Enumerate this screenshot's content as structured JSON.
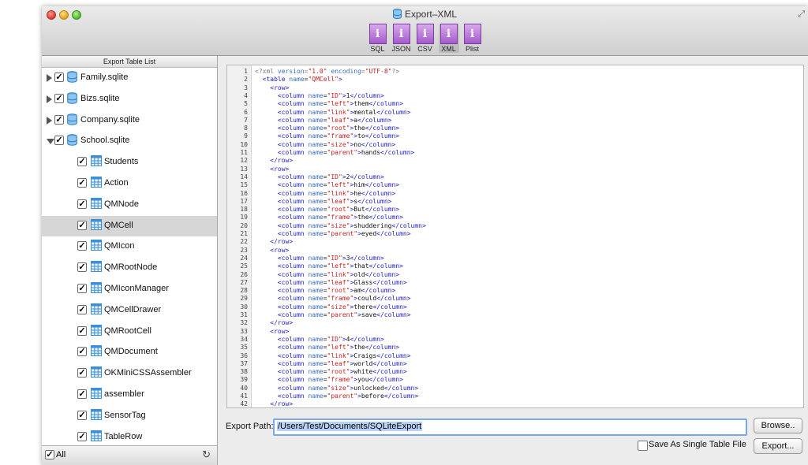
{
  "window": {
    "title": "Export–XML",
    "toolbar": [
      {
        "label": "SQL",
        "icon": "info-icon"
      },
      {
        "label": "JSON",
        "icon": "info-icon"
      },
      {
        "label": "CSV",
        "icon": "info-icon"
      },
      {
        "label": "XML",
        "icon": "info-icon",
        "selected": true
      },
      {
        "label": "Plist",
        "icon": "info-icon"
      }
    ]
  },
  "sidebar": {
    "header": "Export Table List",
    "databases": [
      {
        "label": "Family.sqlite",
        "expanded": false,
        "checked": true
      },
      {
        "label": "Bizs.sqlite",
        "expanded": false,
        "checked": true
      },
      {
        "label": "Company.sqlite",
        "expanded": false,
        "checked": true
      },
      {
        "label": "School.sqlite",
        "expanded": true,
        "checked": true
      }
    ],
    "tables": [
      {
        "label": "Students",
        "checked": true
      },
      {
        "label": "Action",
        "checked": true
      },
      {
        "label": "QMNode",
        "checked": true
      },
      {
        "label": "QMCell",
        "checked": true,
        "selected": true
      },
      {
        "label": "QMIcon",
        "checked": true
      },
      {
        "label": "QMRootNode",
        "checked": true
      },
      {
        "label": "QMIconManager",
        "checked": true
      },
      {
        "label": "QMCellDrawer",
        "checked": true
      },
      {
        "label": "QMRootCell",
        "checked": true
      },
      {
        "label": "QMDocument",
        "checked": true
      },
      {
        "label": "OKMiniCSSAssembler",
        "checked": true
      },
      {
        "label": "assembler",
        "checked": true
      },
      {
        "label": "SensorTag",
        "checked": true
      },
      {
        "label": "TableRow",
        "checked": true
      }
    ],
    "footer": {
      "all_label": "All",
      "all_checked": true,
      "refresh_icon": "refresh-icon"
    }
  },
  "code": {
    "lines": [
      {
        "indent": "",
        "type": "decl",
        "text": "<?xml version=\"1.0\" encoding=\"UTF-8\"?>"
      },
      {
        "indent": "  ",
        "type": "table",
        "name": "QMCell"
      },
      {
        "indent": "    ",
        "type": "tag",
        "text": "<row>"
      },
      {
        "indent": "      ",
        "type": "col",
        "name": "ID",
        "value": "1"
      },
      {
        "indent": "      ",
        "type": "col",
        "name": "left",
        "value": "them"
      },
      {
        "indent": "      ",
        "type": "col",
        "name": "link",
        "value": "mental"
      },
      {
        "indent": "      ",
        "type": "col",
        "name": "leaf",
        "value": "a"
      },
      {
        "indent": "      ",
        "type": "col",
        "name": "root",
        "value": "the"
      },
      {
        "indent": "      ",
        "type": "col",
        "name": "frame",
        "value": "to"
      },
      {
        "indent": "      ",
        "type": "col",
        "name": "size",
        "value": "no"
      },
      {
        "indent": "      ",
        "type": "col",
        "name": "parent",
        "value": "hands"
      },
      {
        "indent": "    ",
        "type": "tag",
        "text": "</row>"
      },
      {
        "indent": "    ",
        "type": "tag",
        "text": "<row>"
      },
      {
        "indent": "      ",
        "type": "col",
        "name": "ID",
        "value": "2"
      },
      {
        "indent": "      ",
        "type": "col",
        "name": "left",
        "value": "him"
      },
      {
        "indent": "      ",
        "type": "col",
        "name": "link",
        "value": "he"
      },
      {
        "indent": "      ",
        "type": "col",
        "name": "leaf",
        "value": "s"
      },
      {
        "indent": "      ",
        "type": "col",
        "name": "root",
        "value": "But"
      },
      {
        "indent": "      ",
        "type": "col",
        "name": "frame",
        "value": "the"
      },
      {
        "indent": "      ",
        "type": "col",
        "name": "size",
        "value": "shuddering"
      },
      {
        "indent": "      ",
        "type": "col",
        "name": "parent",
        "value": "eyed"
      },
      {
        "indent": "    ",
        "type": "tag",
        "text": "</row>"
      },
      {
        "indent": "    ",
        "type": "tag",
        "text": "<row>"
      },
      {
        "indent": "      ",
        "type": "col",
        "name": "ID",
        "value": "3"
      },
      {
        "indent": "      ",
        "type": "col",
        "name": "left",
        "value": "that"
      },
      {
        "indent": "      ",
        "type": "col",
        "name": "link",
        "value": "old"
      },
      {
        "indent": "      ",
        "type": "col",
        "name": "leaf",
        "value": "Glass"
      },
      {
        "indent": "      ",
        "type": "col",
        "name": "root",
        "value": "am"
      },
      {
        "indent": "      ",
        "type": "col",
        "name": "frame",
        "value": "could"
      },
      {
        "indent": "      ",
        "type": "col",
        "name": "size",
        "value": "there"
      },
      {
        "indent": "      ",
        "type": "col",
        "name": "parent",
        "value": "save"
      },
      {
        "indent": "    ",
        "type": "tag",
        "text": "</row>"
      },
      {
        "indent": "    ",
        "type": "tag",
        "text": "<row>"
      },
      {
        "indent": "      ",
        "type": "col",
        "name": "ID",
        "value": "4"
      },
      {
        "indent": "      ",
        "type": "col",
        "name": "left",
        "value": "the"
      },
      {
        "indent": "      ",
        "type": "col",
        "name": "link",
        "value": "Craigs"
      },
      {
        "indent": "      ",
        "type": "col",
        "name": "leaf",
        "value": "world"
      },
      {
        "indent": "      ",
        "type": "col",
        "name": "root",
        "value": "white"
      },
      {
        "indent": "      ",
        "type": "col",
        "name": "frame",
        "value": "you"
      },
      {
        "indent": "      ",
        "type": "col",
        "name": "size",
        "value": "unlocked"
      },
      {
        "indent": "      ",
        "type": "col",
        "name": "parent",
        "value": "before"
      },
      {
        "indent": "    ",
        "type": "tag",
        "text": "</row>"
      }
    ]
  },
  "export": {
    "path_label": "Export Path:",
    "path_value": "/Users/Test/Documents/SQLiteExport",
    "browse_label": "Browse..",
    "single_file_label": "Save As Single Table File",
    "single_file_checked": false,
    "export_label": "Export..."
  },
  "colors": {
    "accent": "#7aa7e6",
    "selection": "#d6d6d6",
    "tag": "#1f23c6",
    "string": "#c21f1f"
  }
}
